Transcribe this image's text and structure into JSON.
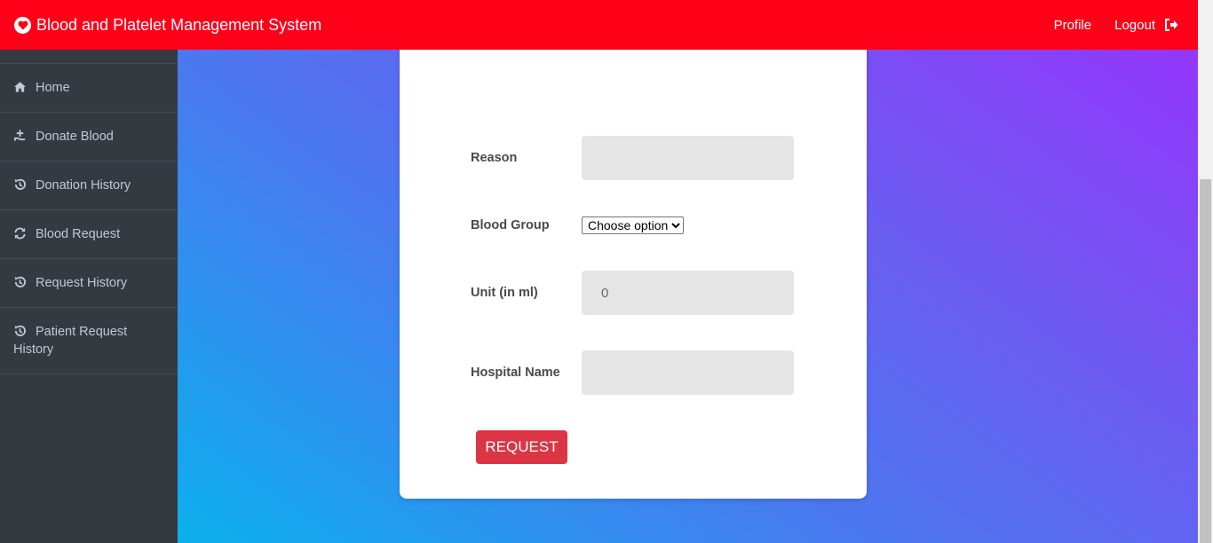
{
  "header": {
    "title": "Blood and Platelet Management System",
    "logo_icon": "heart-icon",
    "profile_label": "Profile",
    "logout_label": "Logout",
    "background": "#ff0019"
  },
  "sidebar": {
    "items": [
      {
        "label": "Home",
        "icon": "home-icon"
      },
      {
        "label": "Donate Blood",
        "icon": "donate-icon"
      },
      {
        "label": "Donation History",
        "icon": "history-icon"
      },
      {
        "label": "Blood Request",
        "icon": "refresh-icon"
      },
      {
        "label": "Request History",
        "icon": "history-icon"
      },
      {
        "label": "Patient Request History",
        "icon": "history-icon"
      }
    ]
  },
  "form": {
    "reason_label": "Reason",
    "reason_value": "",
    "blood_group_label": "Blood Group",
    "blood_group_selected": "Choose option",
    "unit_label": "Unit (in ml)",
    "unit_value": "0",
    "hospital_label": "Hospital Name",
    "hospital_value": "",
    "submit_label": "REQUEST",
    "submit_color": "#dc3545"
  }
}
